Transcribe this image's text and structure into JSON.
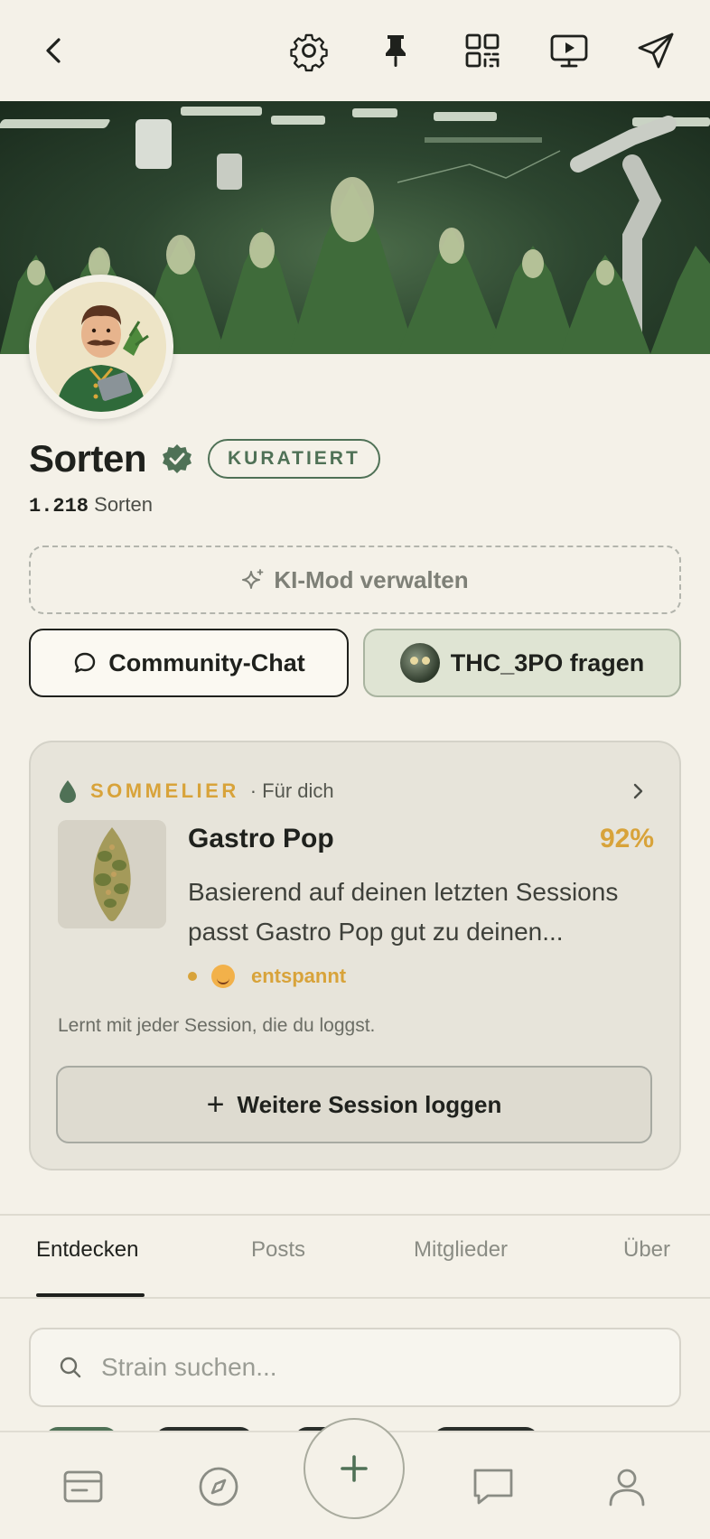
{
  "header": {
    "icons": [
      "back-icon",
      "gear-icon",
      "pin-icon",
      "qr-code-icon",
      "screen-play-icon",
      "send-icon"
    ]
  },
  "community": {
    "title": "Sorten",
    "badge": "KURATIERT",
    "count": "1.218",
    "count_label": "Sorten"
  },
  "actions": {
    "ki_mod_label": "KI-Mod verwalten",
    "chat_label": "Community-Chat",
    "ask_label": "THC_3PO fragen"
  },
  "sommelier": {
    "label": "SOMMELIER",
    "sub": "· Für dich",
    "strain_name": "Gastro Pop",
    "match_percent": "92%",
    "description": "Basierend auf deinen letzten Sessions passt Gastro Pop gut zu deinen...",
    "mood": "entspannt",
    "learn_text": "Lernt mit jeder Session, die du loggst.",
    "log_button": "Weitere Session loggen",
    "accent_color": "#d8a33a"
  },
  "tabs": [
    {
      "label": "Entdecken",
      "active": true
    },
    {
      "label": "Posts",
      "active": false
    },
    {
      "label": "Mitglieder",
      "active": false
    },
    {
      "label": "Über",
      "active": false
    }
  ],
  "search": {
    "placeholder": "Strain suchen...",
    "value": ""
  },
  "bottom_nav": {
    "icons": [
      "feed-icon",
      "compass-icon",
      "plus-icon",
      "chat-icon",
      "profile-icon"
    ]
  },
  "colors": {
    "background": "#f4f1e8",
    "brand_green": "#4f7156",
    "accent_gold": "#d8a33a"
  }
}
